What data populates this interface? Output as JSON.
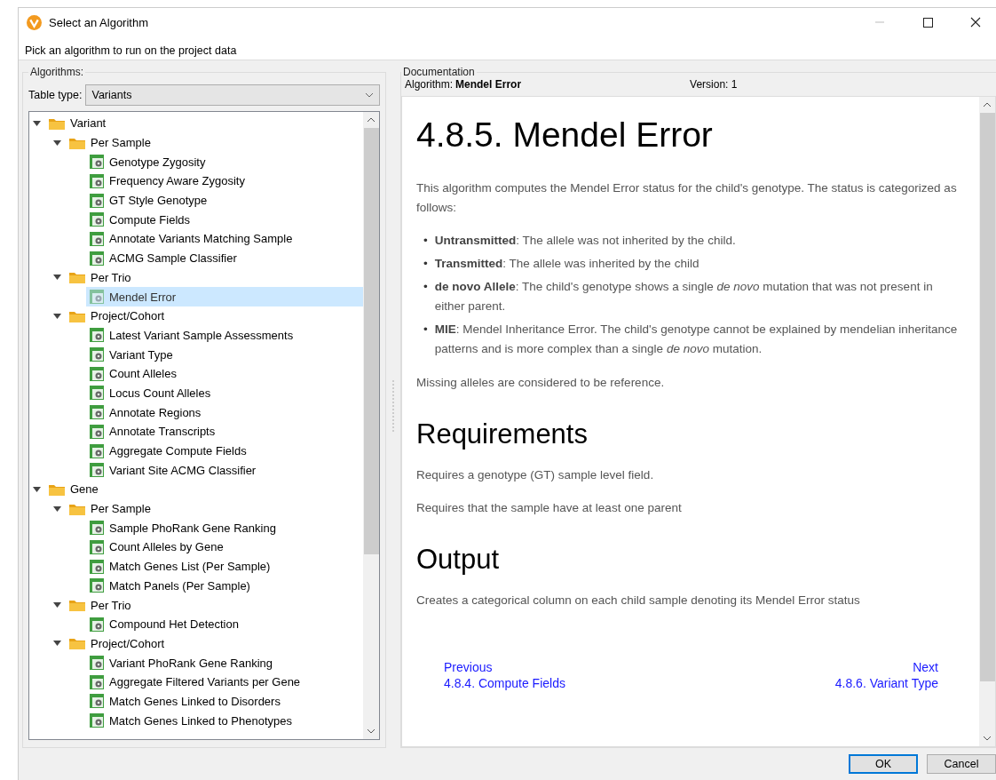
{
  "window": {
    "title": "Select an Algorithm"
  },
  "prompt": "Pick an algorithm to run on the project data",
  "algorithms_panel": {
    "legend": "Algorithms:",
    "table_type_label": "Table type:",
    "table_type_value": "Variants",
    "tree": [
      {
        "label": "Variant",
        "kind": "folder",
        "expanded": true,
        "selected": false,
        "children": [
          {
            "label": "Per Sample",
            "kind": "folder",
            "expanded": true,
            "selected": false,
            "children": [
              {
                "label": "Genotype Zygosity",
                "kind": "algorithm",
                "selected": false
              },
              {
                "label": "Frequency Aware Zygosity",
                "kind": "algorithm",
                "selected": false
              },
              {
                "label": "GT Style Genotype",
                "kind": "algorithm",
                "selected": false
              },
              {
                "label": "Compute Fields",
                "kind": "algorithm",
                "selected": false
              },
              {
                "label": "Annotate Variants Matching Sample",
                "kind": "algorithm",
                "selected": false
              },
              {
                "label": "ACMG Sample Classifier",
                "kind": "algorithm",
                "selected": false
              }
            ]
          },
          {
            "label": "Per Trio",
            "kind": "folder",
            "expanded": true,
            "selected": false,
            "children": [
              {
                "label": "Mendel Error",
                "kind": "algorithm",
                "selected": true
              }
            ]
          },
          {
            "label": "Project/Cohort",
            "kind": "folder",
            "expanded": true,
            "selected": false,
            "children": [
              {
                "label": "Latest Variant Sample Assessments",
                "kind": "algorithm",
                "selected": false
              },
              {
                "label": "Variant Type",
                "kind": "algorithm",
                "selected": false
              },
              {
                "label": "Count Alleles",
                "kind": "algorithm",
                "selected": false
              },
              {
                "label": "Locus Count Alleles",
                "kind": "algorithm",
                "selected": false
              },
              {
                "label": "Annotate Regions",
                "kind": "algorithm",
                "selected": false
              },
              {
                "label": "Annotate Transcripts",
                "kind": "algorithm",
                "selected": false
              },
              {
                "label": "Aggregate Compute Fields",
                "kind": "algorithm",
                "selected": false
              },
              {
                "label": "Variant Site ACMG Classifier",
                "kind": "algorithm",
                "selected": false
              }
            ]
          }
        ]
      },
      {
        "label": "Gene",
        "kind": "folder",
        "expanded": true,
        "selected": false,
        "children": [
          {
            "label": "Per Sample",
            "kind": "folder",
            "expanded": true,
            "selected": false,
            "children": [
              {
                "label": "Sample PhoRank Gene Ranking",
                "kind": "algorithm",
                "selected": false
              },
              {
                "label": "Count Alleles by Gene",
                "kind": "algorithm",
                "selected": false
              },
              {
                "label": "Match Genes List (Per Sample)",
                "kind": "algorithm",
                "selected": false
              },
              {
                "label": "Match Panels (Per Sample)",
                "kind": "algorithm",
                "selected": false
              }
            ]
          },
          {
            "label": "Per Trio",
            "kind": "folder",
            "expanded": true,
            "selected": false,
            "children": [
              {
                "label": "Compound Het Detection",
                "kind": "algorithm",
                "selected": false
              }
            ]
          },
          {
            "label": "Project/Cohort",
            "kind": "folder",
            "expanded": true,
            "selected": false,
            "children": [
              {
                "label": "Variant PhoRank Gene Ranking",
                "kind": "algorithm",
                "selected": false
              },
              {
                "label": "Aggregate Filtered Variants per Gene",
                "kind": "algorithm",
                "selected": false
              },
              {
                "label": "Match Genes Linked to Disorders",
                "kind": "algorithm",
                "selected": false
              },
              {
                "label": "Match Genes Linked to Phenotypes",
                "kind": "algorithm",
                "selected": false
              }
            ]
          }
        ]
      }
    ]
  },
  "documentation_panel": {
    "legend": "Documentation",
    "algorithm_label": "Algorithm:",
    "algorithm_name": "Mendel Error",
    "version": "Version: 1",
    "content": [
      {
        "kind": "h1",
        "text": "4.8.5. Mendel Error"
      },
      {
        "kind": "p",
        "text": "This algorithm computes the Mendel Error status for the child's genotype. The status is categorized as follows:"
      },
      {
        "kind": "bullets",
        "items": [
          {
            "marker": "•",
            "text": "**Untransmitted**: The allele was not inherited by the child."
          },
          {
            "marker": "•",
            "text": "**Transmitted**: The allele was inherited by the child"
          },
          {
            "marker": "•",
            "text": "**de novo Allele**: The child's genotype shows a single *de novo* mutation that was not present in either parent."
          },
          {
            "marker": "•",
            "text": "**MIE**: Mendel Inheritance Error. The child's genotype cannot be explained by mendelian inheritance patterns and is more complex than a single *de novo* mutation."
          }
        ]
      },
      {
        "kind": "p",
        "text": "Missing alleles are considered to be reference."
      },
      {
        "kind": "h2",
        "text": "Requirements"
      },
      {
        "kind": "p",
        "text": "Requires a genotype (GT) sample level field."
      },
      {
        "kind": "p",
        "text": "Requires that the sample have at least one parent"
      },
      {
        "kind": "h2",
        "text": "Output"
      },
      {
        "kind": "p",
        "text": "Creates a categorical column on each child sample denoting its Mendel Error status"
      }
    ],
    "previous_label": "Previous",
    "previous_link": "4.8.4. Compute Fields",
    "next_label": "Next",
    "next_link": "4.8.6. Variant Type"
  },
  "buttons": [
    {
      "label": "OK",
      "default": true
    },
    {
      "label": "Cancel",
      "default": false
    }
  ]
}
